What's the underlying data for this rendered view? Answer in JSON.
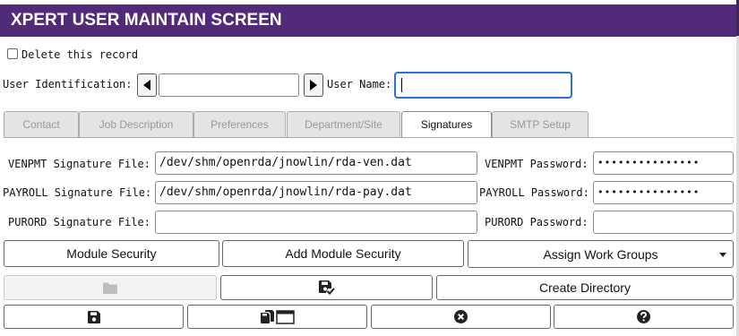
{
  "window": {
    "title": "XPERT USER MAINTAIN SCREEN"
  },
  "delete_record": {
    "label": "Delete this record",
    "checked": false
  },
  "identity": {
    "user_id_label": "User Identification:",
    "user_id_value": "",
    "user_name_label": "User Name:",
    "user_name_value": ""
  },
  "tabs": [
    {
      "label": "Contact",
      "active": false
    },
    {
      "label": "Job Description",
      "active": false
    },
    {
      "label": "Preferences",
      "active": false
    },
    {
      "label": "Department/Site",
      "active": false
    },
    {
      "label": "Signatures",
      "active": true
    },
    {
      "label": "SMTP Setup",
      "active": false
    }
  ],
  "signatures": {
    "venpmt_file_label": "VENPMT Signature File:",
    "venpmt_file_value": "/dev/shm/openrda/jnowlin/rda-ven.dat",
    "venpmt_password_label": "VENPMT Password:",
    "venpmt_password_value": "•••••••••••••••",
    "payroll_file_label": "PAYROLL Signature File:",
    "payroll_file_value": "/dev/shm/openrda/jnowlin/rda-pay.dat",
    "payroll_password_label": "PAYROLL Password:",
    "payroll_password_value": "•••••••••••••••",
    "purord_file_label": "PURORD Signature File:",
    "purord_file_value": "",
    "purord_password_label": "PURORD Password:",
    "purord_password_value": ""
  },
  "buttons": {
    "module_security": "Module Security",
    "add_module_security": "Add Module Security",
    "assign_work_groups": "Assign Work Groups",
    "create_directory": "Create Directory"
  },
  "icons": {
    "folder": "folder-icon",
    "save_check": "save-check-icon",
    "save": "save-icon",
    "save_multi_window": "save-window-icon",
    "cancel": "cancel-icon",
    "help": "help-icon"
  }
}
